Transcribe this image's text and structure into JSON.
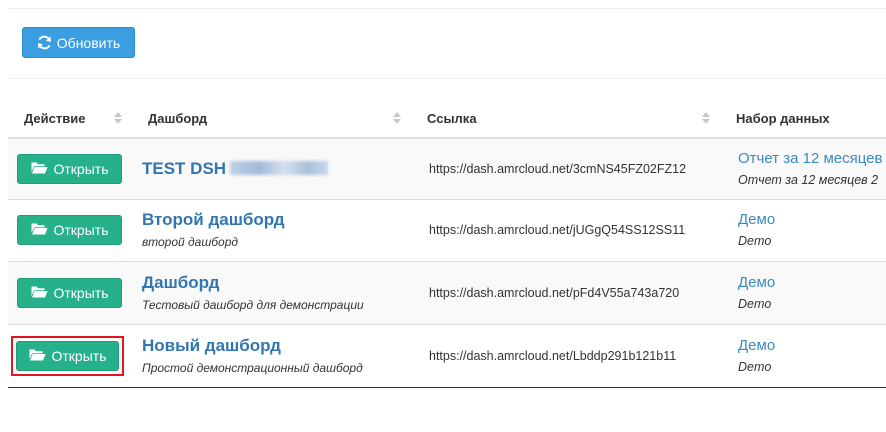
{
  "toolbar": {
    "refresh_label": "Обновить"
  },
  "table": {
    "headers": {
      "action": "Действие",
      "dashboard": "Дашборд",
      "link": "Ссылка",
      "dataset": "Набор данных"
    },
    "rows": [
      {
        "open_label": "Открыть",
        "title": "TEST DSH",
        "title_redacted": true,
        "description": "",
        "link": "https://dash.amrcloud.net/3cmNS45FZ02FZ12",
        "dataset_title": "Отчет за 12 месяцев",
        "dataset_desc": "Отчет за 12 месяцев 2"
      },
      {
        "open_label": "Открыть",
        "title": "Второй дашборд",
        "description": "второй дашборд",
        "link": "https://dash.amrcloud.net/jUGgQ54SS12SS11",
        "dataset_title": "Демо",
        "dataset_desc": "Demo"
      },
      {
        "open_label": "Открыть",
        "title": "Дашборд",
        "description": "Тестовый дашборд для демонстрации",
        "link": "https://dash.amrcloud.net/pFd4V55a743a720",
        "dataset_title": "Демо",
        "dataset_desc": "Demo"
      },
      {
        "open_label": "Открыть",
        "title": "Новый дашборд",
        "description": "Простой демонстрационный дашборд",
        "link": "https://dash.amrcloud.net/Lbddp291b121b11",
        "dataset_title": "Демо",
        "dataset_desc": "Demo",
        "highlighted": true
      }
    ]
  },
  "colors": {
    "primary": "#3a9ee0",
    "success": "#26b18a",
    "link": "#3276b1",
    "highlight": "#e0151f"
  },
  "icons": {
    "refresh": "refresh-icon",
    "open": "folder-open-icon",
    "sort": "sort-icon"
  }
}
